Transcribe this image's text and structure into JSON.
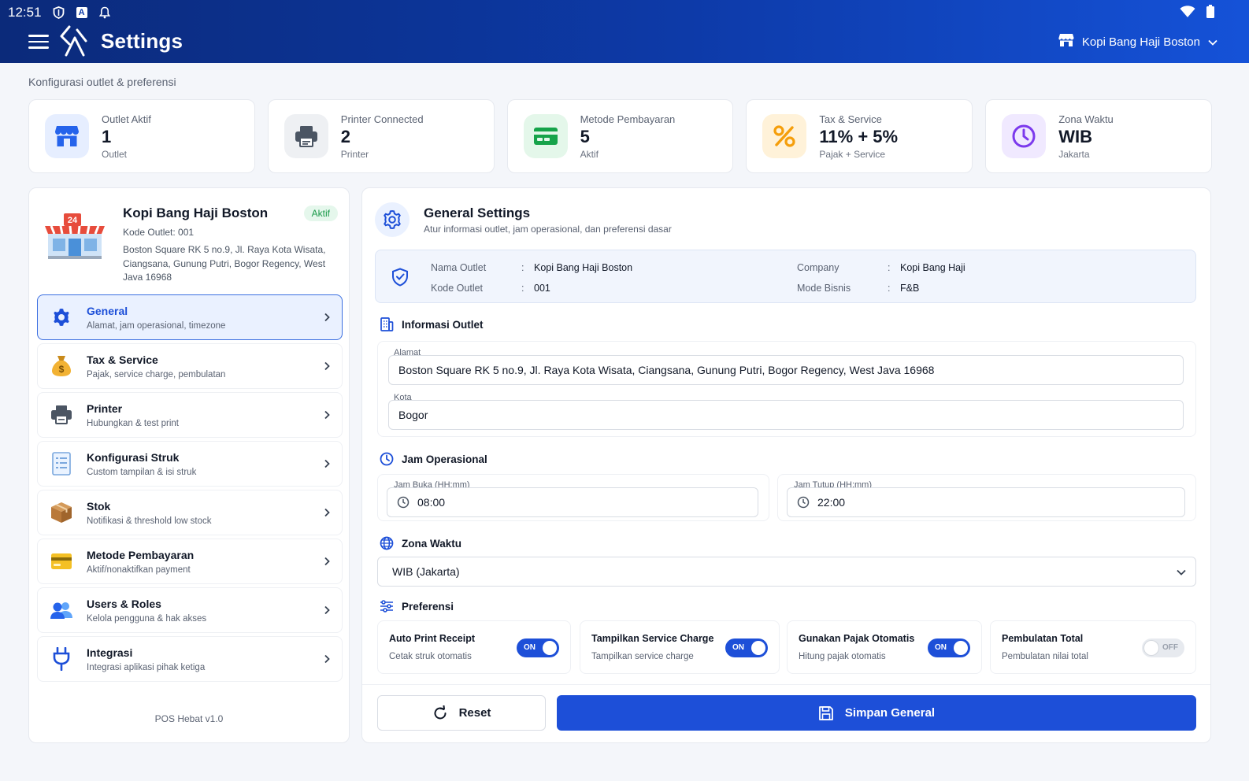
{
  "status": {
    "time": "12:51",
    "a_label": "A"
  },
  "header": {
    "title": "Settings",
    "outlet_name": "Kopi Bang Haji Boston"
  },
  "subtitle": "Konfigurasi outlet & preferensi",
  "stats": [
    {
      "label": "Outlet Aktif",
      "value": "1",
      "unit": "Outlet",
      "icon": "store-icon",
      "color": "#2563eb"
    },
    {
      "label": "Printer Connected",
      "value": "2",
      "unit": "Printer",
      "icon": "printer-icon",
      "color": "#4b5563"
    },
    {
      "label": "Metode Pembayaran",
      "value": "5",
      "unit": "Aktif",
      "icon": "card-icon",
      "color": "#16a34a"
    },
    {
      "label": "Tax & Service",
      "value": "11% + 5%",
      "unit": "Pajak + Service",
      "icon": "percent-icon",
      "color": "#f59e0b"
    },
    {
      "label": "Zona Waktu",
      "value": "WIB",
      "unit": "Jakarta",
      "icon": "clock-icon",
      "color": "#7c3aed"
    }
  ],
  "outlet": {
    "name": "Kopi Bang Haji Boston",
    "badge": "Aktif",
    "code": "Kode Outlet: 001",
    "address": "Boston Square RK 5 no.9, Jl. Raya Kota Wisata, Ciangsana, Gunung Putri, Bogor Regency, West Java 16968",
    "store_sign": "24"
  },
  "nav": [
    {
      "title": "General",
      "desc": "Alamat, jam operasional, timezone",
      "icon": "gear-icon"
    },
    {
      "title": "Tax & Service",
      "desc": "Pajak, service charge, pembulatan",
      "icon": "money-bag-icon"
    },
    {
      "title": "Printer",
      "desc": "Hubungkan & test print",
      "icon": "printer-icon"
    },
    {
      "title": "Konfigurasi Struk",
      "desc": "Custom tampilan & isi struk",
      "icon": "receipt-icon"
    },
    {
      "title": "Stok",
      "desc": "Notifikasi & threshold low stock",
      "icon": "box-icon"
    },
    {
      "title": "Metode Pembayaran",
      "desc": "Aktif/nonaktifkan payment",
      "icon": "card-icon"
    },
    {
      "title": "Users & Roles",
      "desc": "Kelola pengguna & hak akses",
      "icon": "users-icon"
    },
    {
      "title": "Integrasi",
      "desc": "Integrasi aplikasi pihak ketiga",
      "icon": "plug-icon"
    }
  ],
  "version": "POS Hebat v1.0",
  "general": {
    "title": "General Settings",
    "desc": "Atur informasi outlet, jam operasional, dan preferensi dasar",
    "summary": {
      "nama_outlet_label": "Nama Outlet",
      "nama_outlet": "Kopi Bang Haji Boston",
      "kode_outlet_label": "Kode Outlet",
      "kode_outlet": "001",
      "company_label": "Company",
      "company": "Kopi Bang Haji",
      "mode_label": "Mode Bisnis",
      "mode": "F&B",
      "colon": ":"
    },
    "info_title": "Informasi Outlet",
    "alamat_label": "Alamat",
    "alamat": "Boston Square RK 5 no.9, Jl. Raya Kota Wisata, Ciangsana, Gunung Putri, Bogor Regency, West Java 16968",
    "kota_label": "Kota",
    "kota": "Bogor",
    "jam_title": "Jam Operasional",
    "jam_buka_label": "Jam Buka (HH:mm)",
    "jam_buka": "08:00",
    "jam_tutup_label": "Jam Tutup (HH:mm)",
    "jam_tutup": "22:00",
    "zona_title": "Zona Waktu",
    "zona": "WIB (Jakarta)",
    "pref_title": "Preferensi",
    "prefs": [
      {
        "title": "Auto Print Receipt",
        "desc": "Cetak struk otomatis",
        "state": "ON"
      },
      {
        "title": "Tampilkan Service Charge",
        "desc": "Tampilkan service charge",
        "state": "ON"
      },
      {
        "title": "Gunakan Pajak Otomatis",
        "desc": "Hitung pajak otomatis",
        "state": "ON"
      },
      {
        "title": "Pembulatan Total",
        "desc": "Pembulatan nilai total",
        "state": "OFF"
      }
    ],
    "reset_label": "Reset",
    "save_label": "Simpan General"
  },
  "colors": {
    "primary": "#1d4fd8",
    "header_dark": "#0b2a7a",
    "success": "#1a9a4a"
  }
}
